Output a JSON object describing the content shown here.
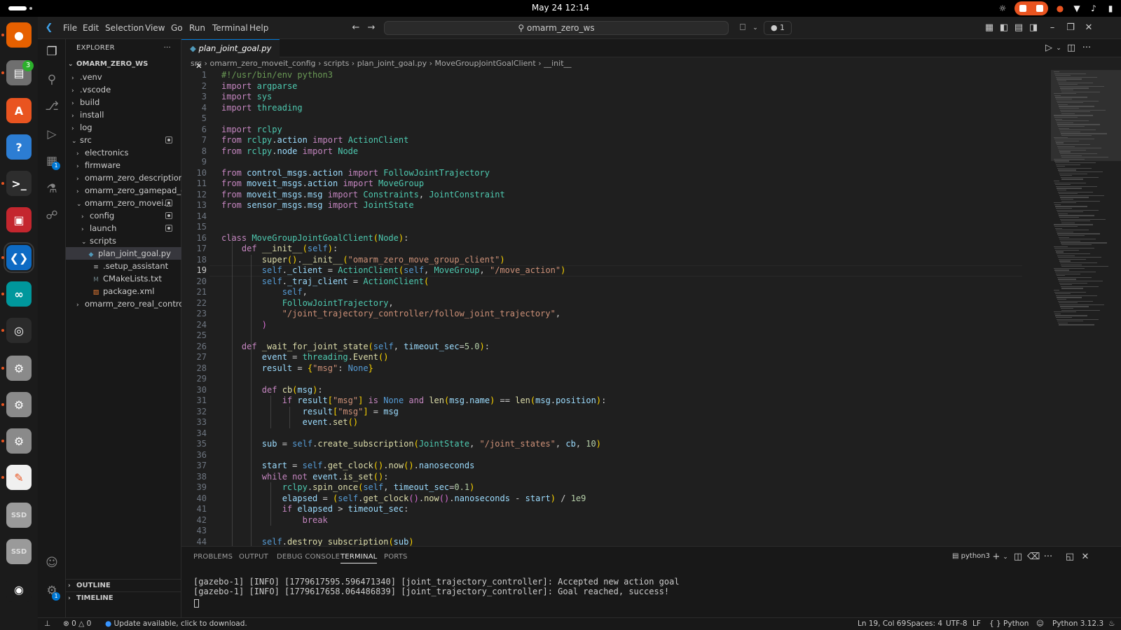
{
  "system": {
    "clock": "May 24  12:14"
  },
  "dock": {
    "badges": {
      "files": "3",
      "extensions": "1"
    },
    "apps": [
      {
        "name": "firefox",
        "color": "#e66000",
        "glyph": "●"
      },
      {
        "name": "files",
        "color": "#6f6f6f",
        "glyph": "▤"
      },
      {
        "name": "software-center",
        "color": "#e95420",
        "glyph": "A"
      },
      {
        "name": "help",
        "color": "#2c7dd3",
        "glyph": "?"
      },
      {
        "name": "terminal",
        "color": "#2d2d2d",
        "glyph": ">_"
      },
      {
        "name": "app-red",
        "color": "#c4262e",
        "glyph": "▣"
      },
      {
        "name": "vscode",
        "color": "#0e6bc4",
        "glyph": "❮❯"
      },
      {
        "name": "arduino",
        "color": "#00979c",
        "glyph": "∞"
      },
      {
        "name": "obs",
        "color": "#2b2b2b",
        "glyph": "◎"
      },
      {
        "name": "settings-1",
        "color": "#8a8a8a",
        "glyph": "⚙"
      },
      {
        "name": "settings-2",
        "color": "#8a8a8a",
        "glyph": "⚙"
      },
      {
        "name": "settings-3",
        "color": "#8a8a8a",
        "glyph": "⚙"
      },
      {
        "name": "text-editor",
        "color": "#f0f0f0",
        "glyph": "✎"
      },
      {
        "name": "ssd-1",
        "color": "#9a9a9a",
        "glyph": "SSD"
      },
      {
        "name": "ssd-2",
        "color": "#9a9a9a",
        "glyph": "SSD"
      },
      {
        "name": "ubuntu",
        "color": "#1b1b1b",
        "glyph": "◉"
      }
    ]
  },
  "menu": [
    "File",
    "Edit",
    "Selection",
    "View",
    "Go",
    "Run",
    "Terminal",
    "Help"
  ],
  "search": {
    "text": "omarm_zero_ws"
  },
  "titlebar": {
    "notif_count": "1"
  },
  "explorer": {
    "header": "EXPLORER",
    "root": "OMARM_ZERO_WS",
    "items": [
      {
        "label": ".venv",
        "depth": 1,
        "kind": "folder",
        "open": false,
        "mod": false
      },
      {
        "label": ".vscode",
        "depth": 1,
        "kind": "folder",
        "open": false,
        "mod": false
      },
      {
        "label": "build",
        "depth": 1,
        "kind": "folder",
        "open": false,
        "mod": false
      },
      {
        "label": "install",
        "depth": 1,
        "kind": "folder",
        "open": false,
        "mod": false
      },
      {
        "label": "log",
        "depth": 1,
        "kind": "folder",
        "open": false,
        "mod": false
      },
      {
        "label": "src",
        "depth": 1,
        "kind": "folder",
        "open": true,
        "mod": true
      },
      {
        "label": "electronics",
        "depth": 2,
        "kind": "folder",
        "open": false,
        "mod": false
      },
      {
        "label": "firmware",
        "depth": 2,
        "kind": "folder",
        "open": false,
        "mod": false
      },
      {
        "label": "omarm_zero_description",
        "depth": 2,
        "kind": "folder",
        "open": false,
        "mod": false
      },
      {
        "label": "omarm_zero_gamepad_c...",
        "depth": 2,
        "kind": "folder",
        "open": false,
        "mod": false
      },
      {
        "label": "omarm_zero_movei...",
        "depth": 2,
        "kind": "folder",
        "open": true,
        "mod": true
      },
      {
        "label": "config",
        "depth": 3,
        "kind": "folder",
        "open": false,
        "mod": true
      },
      {
        "label": "launch",
        "depth": 3,
        "kind": "folder",
        "open": false,
        "mod": true
      },
      {
        "label": "scripts",
        "depth": 3,
        "kind": "folder",
        "open": true,
        "mod": false
      },
      {
        "label": "plan_joint_goal.py",
        "depth": 4,
        "kind": "py",
        "open": false,
        "mod": false,
        "selected": true
      },
      {
        "label": ".setup_assistant",
        "depth": 3,
        "kind": "txt",
        "open": false,
        "mod": false
      },
      {
        "label": "CMakeLists.txt",
        "depth": 3,
        "kind": "cmake",
        "open": false,
        "mod": false
      },
      {
        "label": "package.xml",
        "depth": 3,
        "kind": "xml",
        "open": false,
        "mod": false
      },
      {
        "label": "omarm_zero_real_control",
        "depth": 2,
        "kind": "folder",
        "open": false,
        "mod": false
      }
    ],
    "outline": "OUTLINE",
    "timeline": "TIMELINE"
  },
  "editor": {
    "tab": "plan_joint_goal.py",
    "breadcrumb": [
      "src",
      "omarm_zero_moveit_config",
      "scripts",
      "plan_joint_goal.py",
      "MoveGroupJointGoalClient",
      "__init__"
    ],
    "current_line": 19,
    "lines": [
      "#!/usr/bin/env python3",
      "import argparse",
      "import sys",
      "import threading",
      "",
      "import rclpy",
      "from rclpy.action import ActionClient",
      "from rclpy.node import Node",
      "",
      "from control_msgs.action import FollowJointTrajectory",
      "from moveit_msgs.action import MoveGroup",
      "from moveit_msgs.msg import Constraints, JointConstraint",
      "from sensor_msgs.msg import JointState",
      "",
      "",
      "class MoveGroupJointGoalClient(Node):",
      "    def __init__(self):",
      "        super().__init__(\"omarm_zero_move_group_client\")",
      "        self._client = ActionClient(self, MoveGroup, \"/move_action\")",
      "        self._traj_client = ActionClient(",
      "            self,",
      "            FollowJointTrajectory,",
      "            \"/joint_trajectory_controller/follow_joint_trajectory\",",
      "        )",
      "",
      "    def _wait_for_joint_state(self, timeout_sec=5.0):",
      "        event = threading.Event()",
      "        result = {\"msg\": None}",
      "",
      "        def cb(msg):",
      "            if result[\"msg\"] is None and len(msg.name) == len(msg.position):",
      "                result[\"msg\"] = msg",
      "                event.set()",
      "",
      "        sub = self.create_subscription(JointState, \"/joint_states\", cb, 10)",
      "",
      "        start = self.get_clock().now().nanoseconds",
      "        while not event.is_set():",
      "            rclpy.spin_once(self, timeout_sec=0.1)",
      "            elapsed = (self.get_clock().now().nanoseconds - start) / 1e9",
      "            if elapsed > timeout_sec:",
      "                break",
      "",
      "        self.destroy_subscription(sub)"
    ]
  },
  "panel": {
    "tabs": [
      "PROBLEMS",
      "OUTPUT",
      "DEBUG CONSOLE",
      "TERMINAL",
      "PORTS"
    ],
    "active_tab": "TERMINAL",
    "terminal_name": "python3",
    "terminal_lines": [
      "[gazebo-1] [INFO] [1779617595.596471340] [joint_trajectory_controller]: Accepted new action goal",
      "[gazebo-1] [INFO] [1779617658.064486839] [joint_trajectory_controller]: Goal reached, success!"
    ]
  },
  "statusbar": {
    "errors": "0",
    "warnings": "0",
    "update": "Update available, click to download.",
    "position": "Ln 19, Col 69",
    "spaces": "Spaces: 4",
    "encoding": "UTF-8",
    "eol": "LF",
    "language": "Python",
    "interpreter": "Python 3.12.3"
  },
  "colors": {
    "accent": "#0078d4",
    "ubuntu_orange": "#e95420"
  }
}
